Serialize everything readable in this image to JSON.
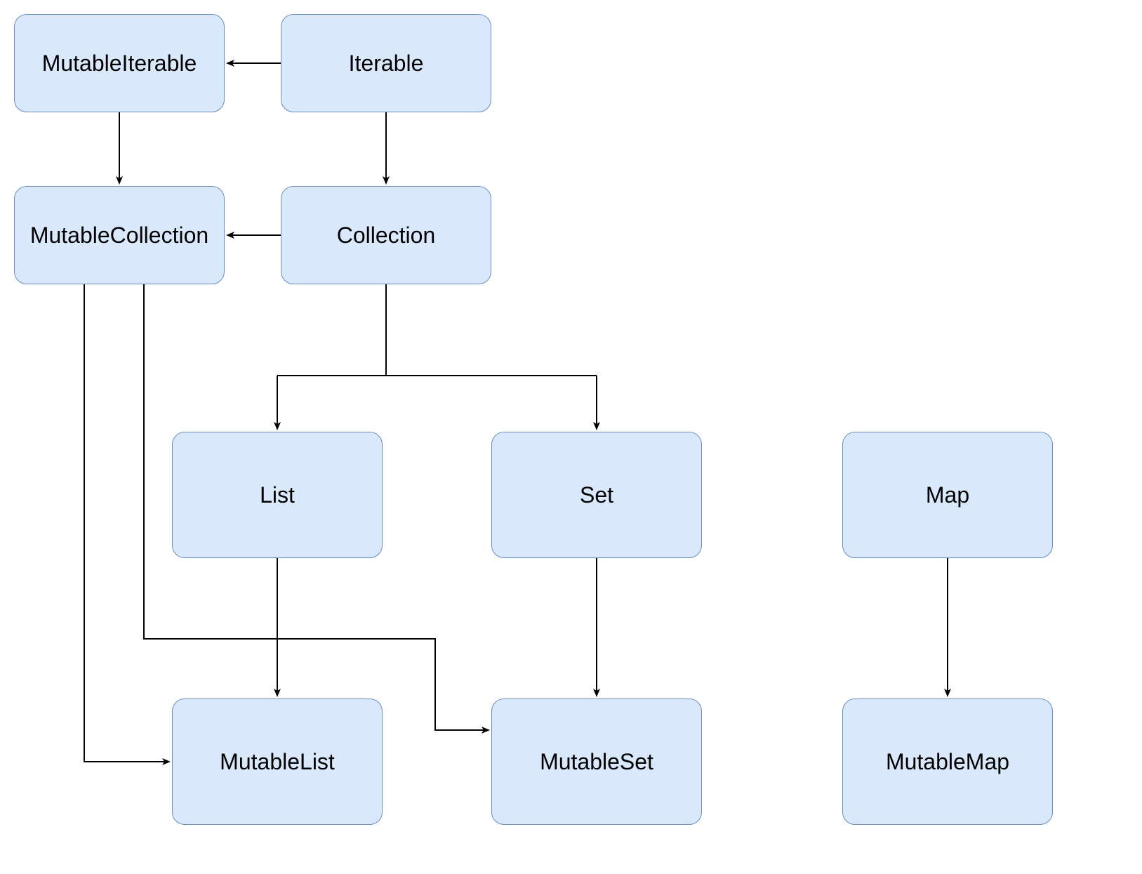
{
  "nodes": {
    "mutable_iterable": {
      "label": "MutableIterable"
    },
    "iterable": {
      "label": "Iterable"
    },
    "mutable_collection": {
      "label": "MutableCollection"
    },
    "collection": {
      "label": "Collection"
    },
    "list": {
      "label": "List"
    },
    "set": {
      "label": "Set"
    },
    "map": {
      "label": "Map"
    },
    "mutable_list": {
      "label": "MutableList"
    },
    "mutable_set": {
      "label": "MutableSet"
    },
    "mutable_map": {
      "label": "MutableMap"
    }
  },
  "colors": {
    "node_fill": "#dae8fc",
    "node_border": "#6c8ebf",
    "edge": "#000000"
  },
  "edges": [
    {
      "from": "iterable",
      "to": "mutable_iterable"
    },
    {
      "from": "iterable",
      "to": "collection"
    },
    {
      "from": "mutable_iterable",
      "to": "mutable_collection"
    },
    {
      "from": "collection",
      "to": "mutable_collection"
    },
    {
      "from": "collection",
      "to": "list"
    },
    {
      "from": "collection",
      "to": "set"
    },
    {
      "from": "list",
      "to": "mutable_list"
    },
    {
      "from": "set",
      "to": "mutable_set"
    },
    {
      "from": "map",
      "to": "mutable_map"
    },
    {
      "from": "mutable_collection",
      "to": "mutable_list"
    },
    {
      "from": "mutable_collection",
      "to": "mutable_set"
    }
  ]
}
